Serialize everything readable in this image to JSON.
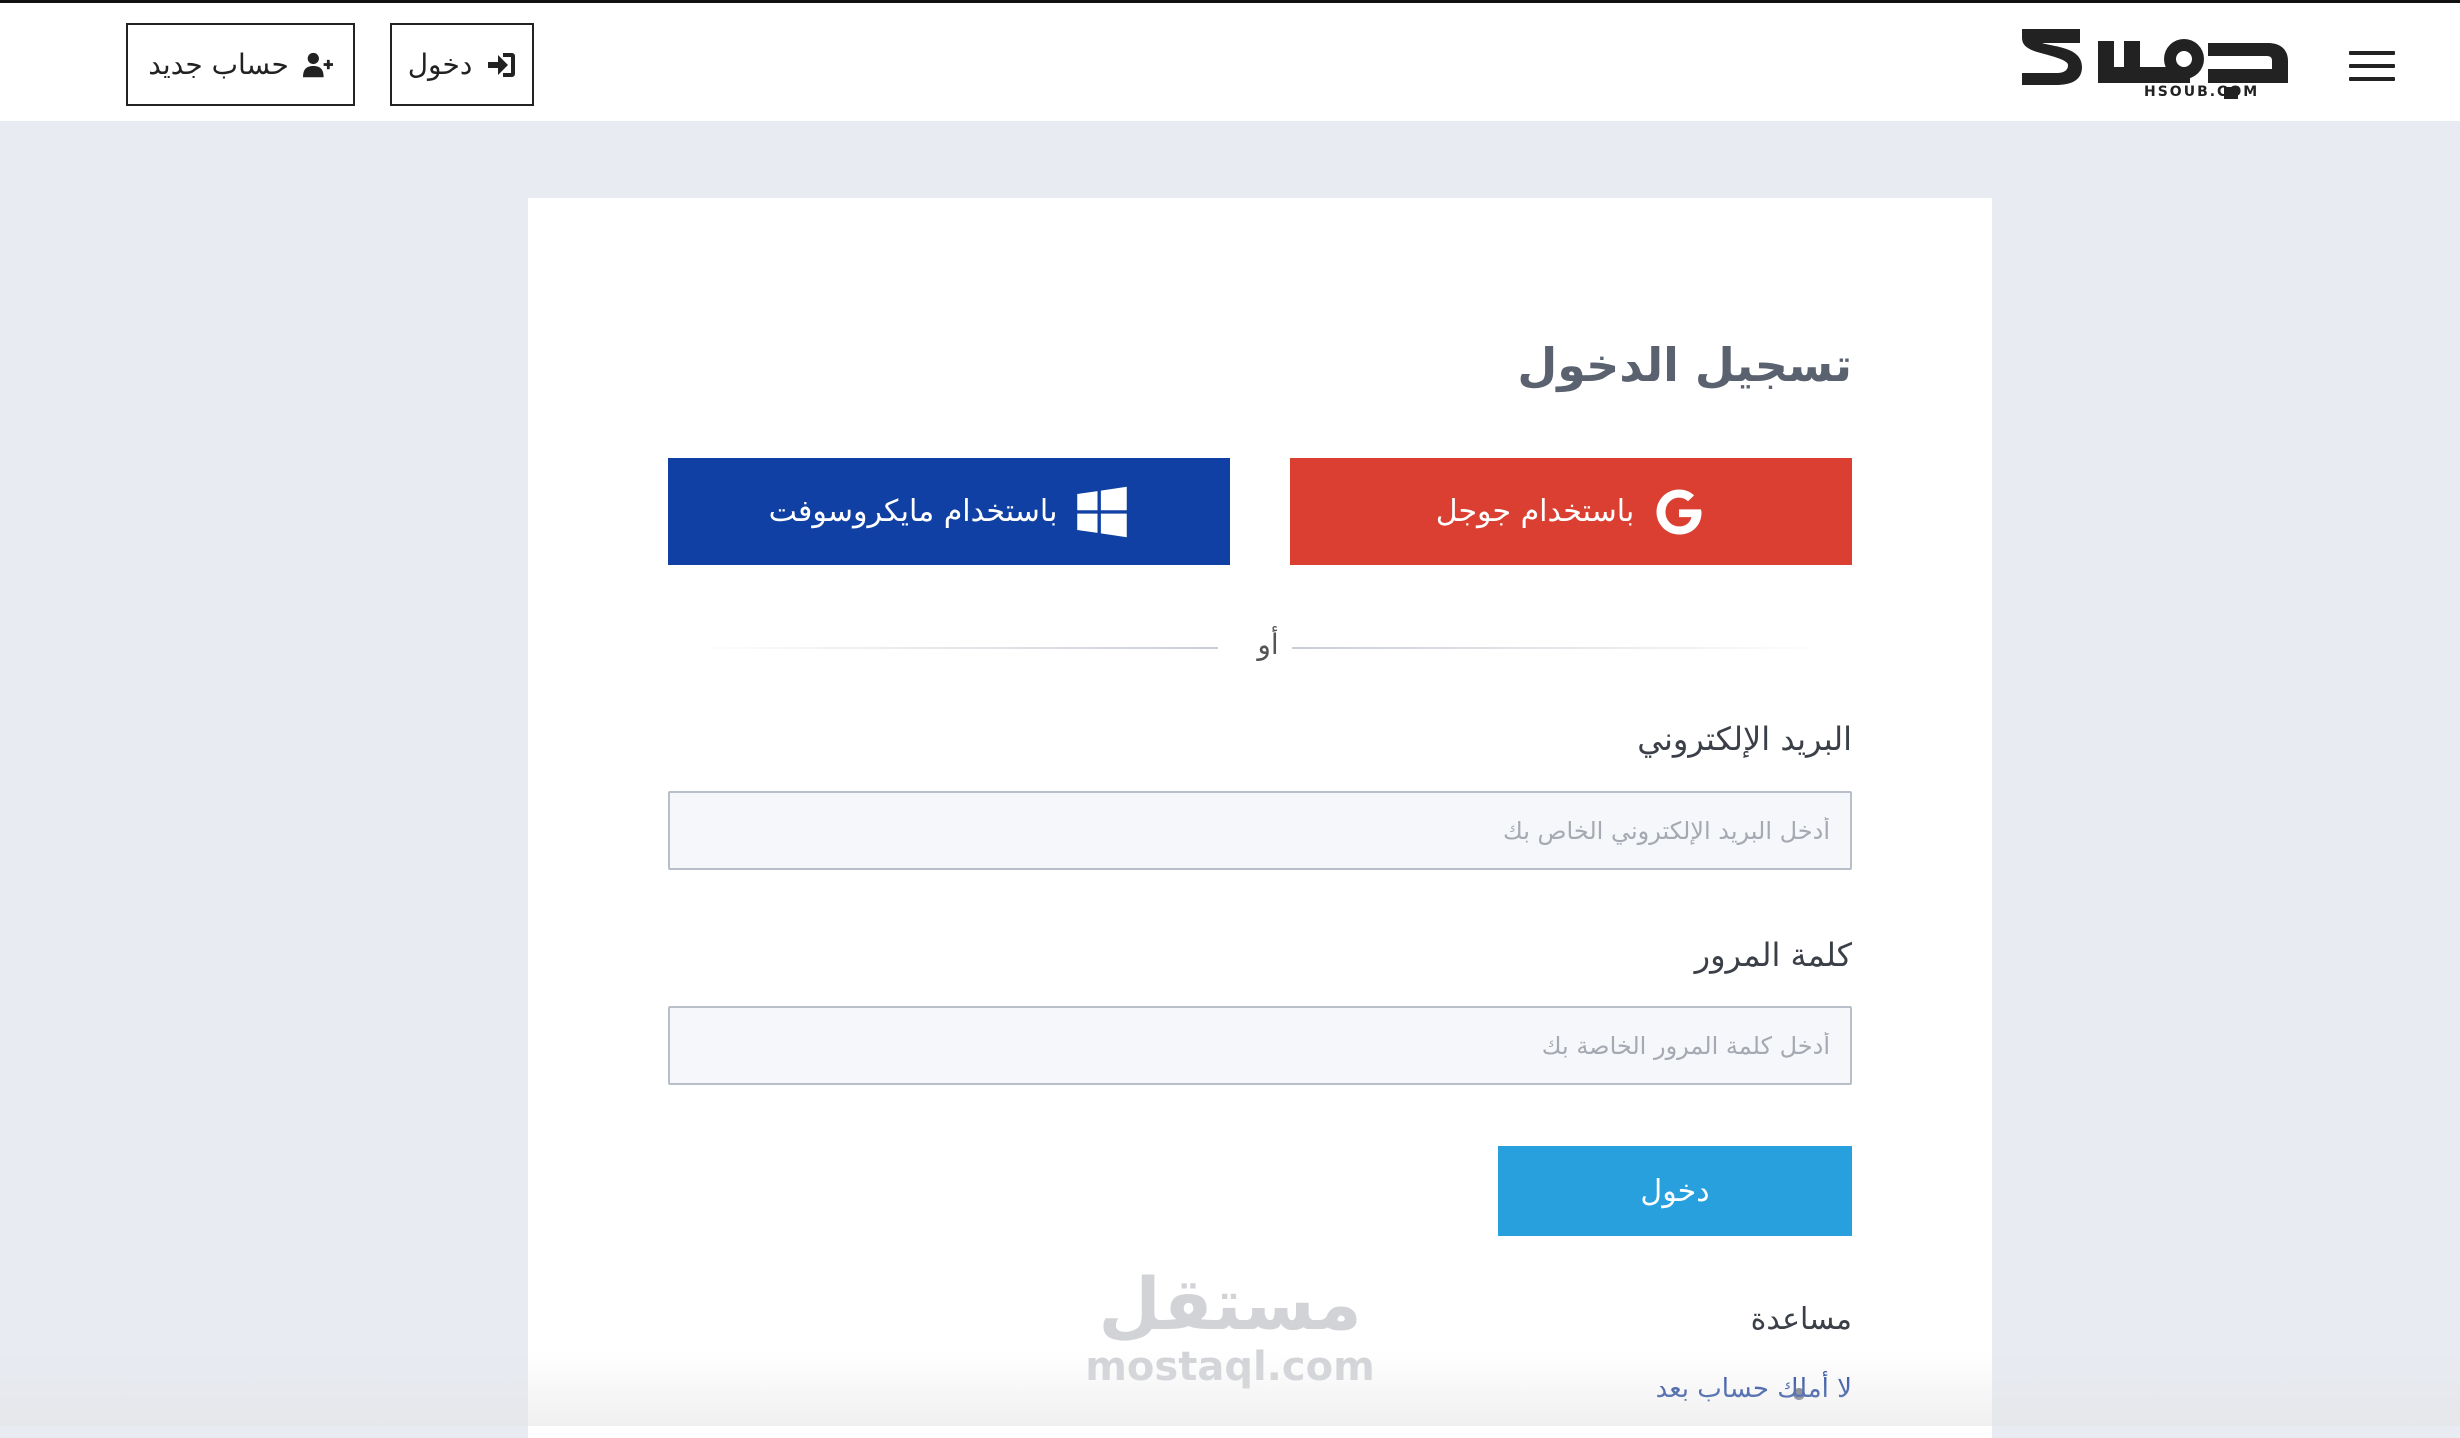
{
  "header": {
    "logo_alt": "حسوب",
    "logo_domain": "HSOUB.COM",
    "menu_icon": "hamburger-menu-icon",
    "signup_label": "حساب جديد",
    "signup_icon": "user-plus-icon",
    "login_label": "دخول",
    "login_icon": "sign-in-icon"
  },
  "login_card": {
    "title": "تسجيل الدخول",
    "google_label": "باستخدام جوجل",
    "google_icon": "google-icon",
    "google_color": "#db3f31",
    "microsoft_label": "باستخدام مايكروسوفت",
    "microsoft_icon": "windows-icon",
    "microsoft_color": "#1140a5",
    "divider_text": "أو",
    "email_label": "البريد الإلكتروني",
    "email_placeholder": "أدخل البريد الإلكتروني الخاص بك",
    "email_value": "",
    "password_label": "كلمة المرور",
    "password_placeholder": "أدخل كلمة المرور الخاصة بك",
    "password_value": "",
    "submit_label": "دخول",
    "submit_color": "#27a0dd",
    "help_title": "مساعدة",
    "help_links": [
      "لا أملك حساب بعد"
    ]
  },
  "watermark": {
    "arabic": "مستقل",
    "latin": "mostaql.com"
  }
}
